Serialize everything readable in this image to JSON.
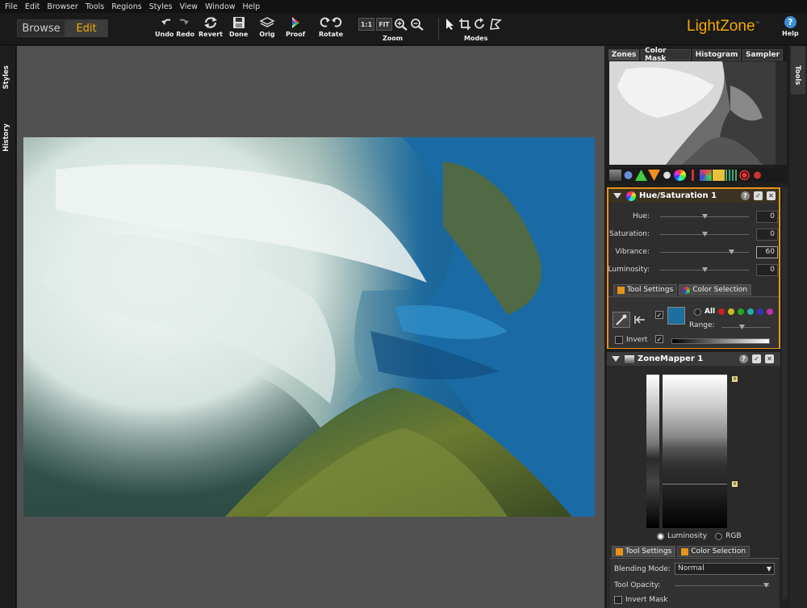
{
  "menu": [
    "File",
    "Edit",
    "Browser",
    "Tools",
    "Regions",
    "Styles",
    "View",
    "Window",
    "Help"
  ],
  "mode_switch": {
    "browse": "Browse",
    "edit": "Edit",
    "active": "Edit"
  },
  "toolbar": {
    "undo_redo": "Undo Redo",
    "revert": "Revert",
    "done": "Done",
    "orig": "Orig",
    "proof": "Proof",
    "rotate": "Rotate",
    "zoom_label": "Zoom",
    "zoom_1to1": "1:1",
    "zoom_fit": "FIT",
    "modes_label": "Modes",
    "help": "Help"
  },
  "brand": {
    "name": "LightZone",
    "tm": "™",
    "color": "#f5a800"
  },
  "left_tabs": {
    "styles": "Styles",
    "history": "History"
  },
  "right_tab": "Tools",
  "panel_tabs": [
    "Zones",
    "Color Mask",
    "Histogram",
    "Sampler"
  ],
  "hue_saturation": {
    "title": "Hue/Saturation 1",
    "rows": [
      {
        "label": "Hue:",
        "value": "0",
        "pos": 0.5
      },
      {
        "label": "Saturation:",
        "value": "0",
        "pos": 0.5
      },
      {
        "label": "Vibrance:",
        "value": "60",
        "pos": 0.8
      },
      {
        "label": "Luminosity:",
        "value": "0",
        "pos": 0.5
      }
    ],
    "tab_tool_settings": "Tool Settings",
    "tab_color_selection": "Color Selection",
    "all_label": "All",
    "range_label": "Range:",
    "invert_label": "Invert",
    "selected_color": "#1e6fa0"
  },
  "zonemapper": {
    "title": "ZoneMapper 1",
    "luminosity": "Luminosity",
    "rgb": "RGB",
    "tab_tool_settings": "Tool Settings",
    "tab_color_selection": "Color Selection",
    "blending_label": "Blending Mode:",
    "blending_value": "Normal",
    "opacity_label": "Tool Opacity:",
    "invert_mask": "Invert Mask"
  },
  "colors": {
    "accent": "#f5a800",
    "panel": "#2e2e2e",
    "canvas": "#515151"
  }
}
